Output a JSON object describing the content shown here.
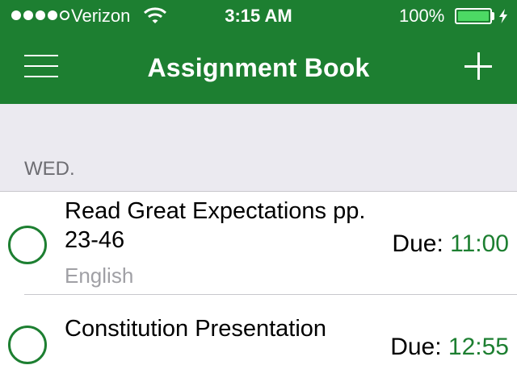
{
  "status_bar": {
    "carrier": "Verizon",
    "time": "3:15 AM",
    "battery": "100%",
    "signal_bars": 4,
    "signal_total": 5
  },
  "nav": {
    "title": "Assignment Book",
    "menu_icon": "hamburger-menu-icon",
    "add_icon": "plus-icon"
  },
  "colors": {
    "brand_green": "#1d7f31",
    "battery_green": "#4cd964",
    "section_background": "#ebeaf0",
    "secondary_text": "#a0a0a5"
  },
  "sections": [
    {
      "label": "WED.",
      "assignments": [
        {
          "title": "Read Great Expectations pp. 23-46",
          "subject": "English",
          "due_label": "Due:",
          "due_time": "11:00",
          "completed": false
        },
        {
          "title": "Constitution Presentation",
          "subject": "",
          "due_label": "Due:",
          "due_time": "12:55",
          "completed": false
        }
      ]
    }
  ]
}
